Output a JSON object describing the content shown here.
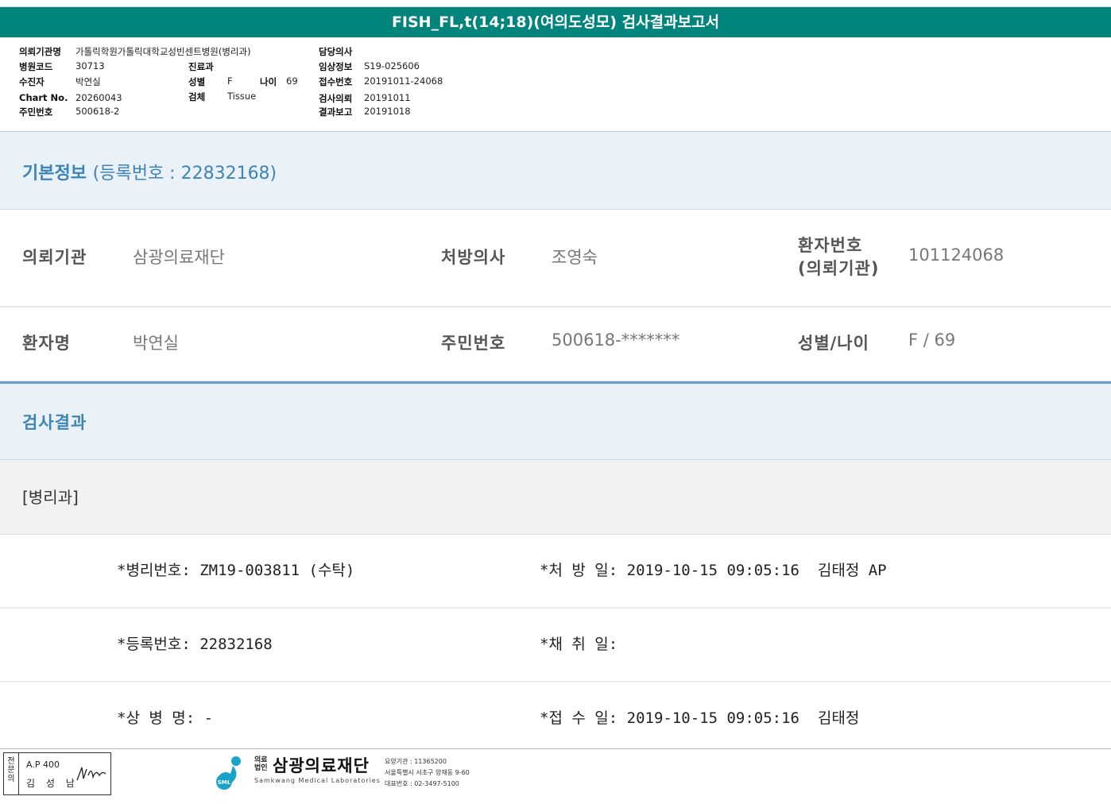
{
  "title": "FISH_FL,t(14;18)(여의도성모) 검사결과보고서",
  "header": {
    "requester_label": "의뢰기관명",
    "requester_value": "가톨릭학원가톨릭대학교성빈센트병원(병리과)",
    "hospcode_label": "병원코드",
    "hospcode_value": "30713",
    "patient_label": "수진자",
    "patient_value": "박연실",
    "chart_label": "Chart No.",
    "chart_value": "20260043",
    "idnum_label": "주민번호",
    "idnum_value": "500618-2",
    "dept_label": "진료과",
    "sex_label": "성별",
    "sex_value": "F",
    "age_label": "나이",
    "age_value": "69",
    "specimen_label": "검체",
    "specimen_value": "Tissue",
    "doctor_label": "담당의사",
    "clinical_label": "임상정보",
    "clinical_value": "S19-025606",
    "receipt_label": "접수번호",
    "receipt_value": "20191011-24068",
    "testreq_label": "검사의뢰",
    "testreq_value": "20191011",
    "report_label": "결과보고",
    "report_value": "20191018"
  },
  "basic": {
    "title": "기본정보",
    "reg": "(등록번호 : 22832168)",
    "r1": {
      "l1": "의뢰기관",
      "v1": "삼광의료재단",
      "l2": "처방의사",
      "v2": "조영숙",
      "l3a": "환자번호",
      "l3b": "(의뢰기관)",
      "v3": "101124068"
    },
    "r2": {
      "l1": "환자명",
      "v1": "박연실",
      "l2": "주민번호",
      "v2": "500618-*******",
      "l3": "성별/나이",
      "v3": "F / 69"
    }
  },
  "result": {
    "title": "검사결과",
    "dept": "[병리과]",
    "rows": [
      {
        "c1": "*병리번호: ZM19-003811 (수탁)",
        "c2": "*처 방 일: 2019-10-15 09:05:16  김태정 AP"
      },
      {
        "c1": "*등록번호: 22832168",
        "c2": "*채 취 일:"
      },
      {
        "c1": "*상 병 명: -",
        "c2": "*접 수 일: 2019-10-15 09:05:16  김태정"
      }
    ]
  },
  "footer": {
    "stamp_side": "전문의",
    "stamp_r1": "A.P 400",
    "stamp_r2": "김 성 남",
    "org_small1": "의료",
    "org_small2": "법인",
    "org_name": "삼광의료재단",
    "org_en": "Samkwang Medical Laboratories",
    "logo_text": "SML",
    "info1": "요양기관 : 11365200",
    "info2": "서울특별시 서초구 양재동 9-60",
    "info3": "대표번호 : 02-3497-5100"
  },
  "colors": {
    "title_bar": "#00847c",
    "section_bg": "#eaf1f7",
    "section_title": "#3d84b8"
  }
}
